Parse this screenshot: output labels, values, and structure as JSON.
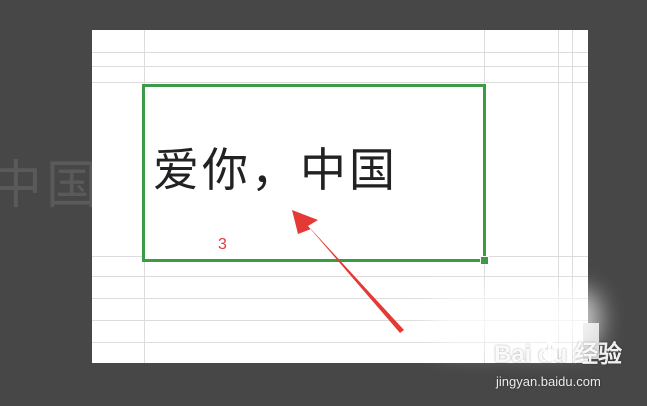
{
  "background_text": "中国",
  "cell": {
    "text": "爱你，中国"
  },
  "step_label": "3",
  "watermark": {
    "brand": "Bai du 经验",
    "url": "jingyan.baidu.com"
  },
  "colors": {
    "selection": "#3d9a47",
    "annotation": "#e03a3a",
    "backdrop": "#474747"
  },
  "icons": {
    "annotation_arrow": "arrow-pointing-up-left-icon",
    "watermark_logo": "paw-icon"
  }
}
